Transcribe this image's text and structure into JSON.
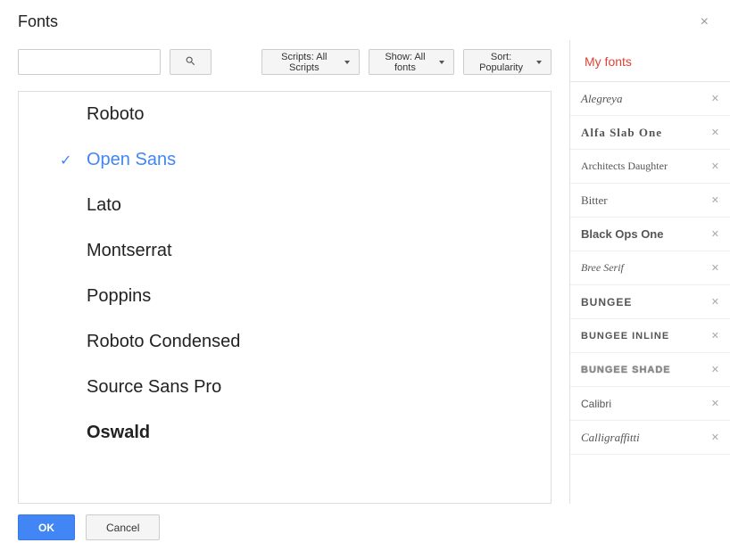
{
  "title": "Fonts",
  "toolbar": {
    "search_value": "",
    "scripts_label": "Scripts: All Scripts",
    "show_label": "Show: All fonts",
    "sort_label": "Sort: Popularity"
  },
  "font_list": [
    {
      "name": "Roboto",
      "selected": false
    },
    {
      "name": "Open Sans",
      "selected": true
    },
    {
      "name": "Lato",
      "selected": false
    },
    {
      "name": "Montserrat",
      "selected": false
    },
    {
      "name": "Poppins",
      "selected": false
    },
    {
      "name": "Roboto Condensed",
      "selected": false
    },
    {
      "name": "Source Sans Pro",
      "selected": false
    },
    {
      "name": "Oswald",
      "selected": false
    }
  ],
  "my_fonts_title": "My fonts",
  "my_fonts": [
    "Alegreya",
    "Alfa Slab One",
    "Architects Daughter",
    "Bitter",
    "Black Ops One",
    "Bree Serif",
    "Bungee",
    "Bungee Inline",
    "Bungee Shade",
    "Calibri",
    "Calligraffitti"
  ],
  "buttons": {
    "ok": "OK",
    "cancel": "Cancel"
  }
}
